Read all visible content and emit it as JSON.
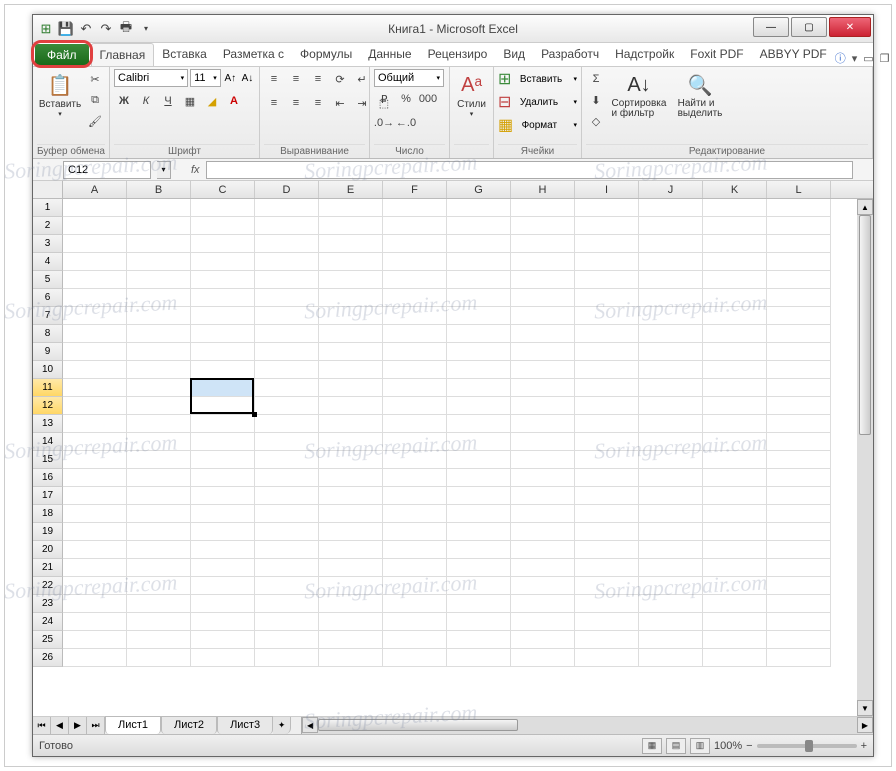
{
  "title": "Книга1 - Microsoft Excel",
  "qat_icons": [
    "excel-icon",
    "save-icon",
    "undo-icon",
    "redo-icon",
    "print-icon",
    "dropdown-icon"
  ],
  "tabs": {
    "file": "Файл",
    "items": [
      "Главная",
      "Вставка",
      "Разметка с",
      "Формулы",
      "Данные",
      "Рецензиро",
      "Вид",
      "Разработч",
      "Надстройк",
      "Foxit PDF",
      "ABBYY PDF"
    ],
    "active": "Главная"
  },
  "ribbon": {
    "clipboard": {
      "label": "Буфер обмена",
      "paste": "Вставить"
    },
    "font": {
      "label": "Шрифт",
      "name": "Calibri",
      "size": "11"
    },
    "alignment": {
      "label": "Выравнивание"
    },
    "number": {
      "label": "Число",
      "format": "Общий"
    },
    "styles": {
      "label": "",
      "styles_btn": "Стили"
    },
    "cells": {
      "label": "Ячейки",
      "insert": "Вставить",
      "delete": "Удалить",
      "format": "Формат"
    },
    "editing": {
      "label": "Редактирование",
      "sort": "Сортировка\nи фильтр",
      "find": "Найти и\nвыделить"
    }
  },
  "name_box": "C12",
  "formula": "",
  "columns": [
    "A",
    "B",
    "C",
    "D",
    "E",
    "F",
    "G",
    "H",
    "I",
    "J",
    "K",
    "L"
  ],
  "rows_count": 26,
  "selection": {
    "col": "C",
    "rows": [
      11,
      12
    ],
    "active_row": 12
  },
  "sheets": [
    "Лист1",
    "Лист2",
    "Лист3"
  ],
  "active_sheet": "Лист1",
  "status": {
    "ready": "Готово",
    "zoom": "100%"
  },
  "watermark_text": "Soringpcrepair.com"
}
